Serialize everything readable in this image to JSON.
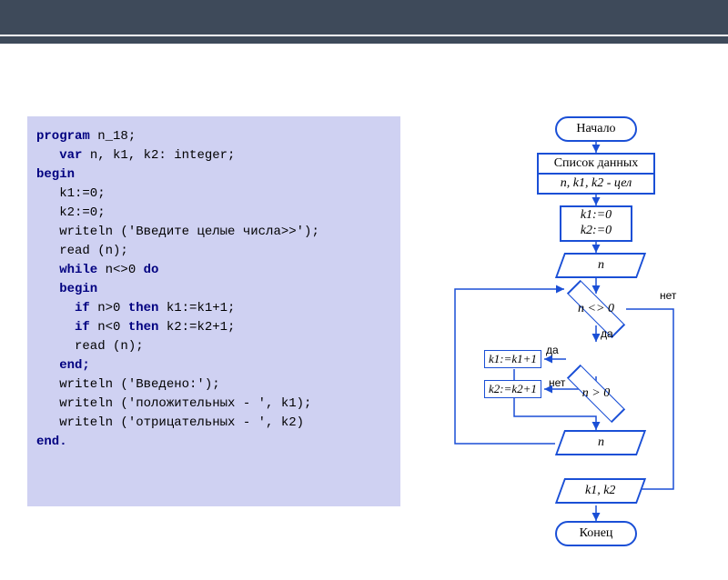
{
  "code": {
    "l1_a": "program",
    "l1_b": " n_18;",
    "l2_a": "   var",
    "l2_b": " n, k1, k2: integer;",
    "l3": "begin",
    "l4": "   k1:=0;",
    "l5": "   k2:=0;",
    "l6": "   writeln ('Введите целые числа>>');",
    "l7": "   read (n);",
    "l8_a": "   while",
    "l8_b": " n<>0 ",
    "l8_c": "do",
    "l9": "   begin",
    "l10_a": "     if",
    "l10_b": " n>0 ",
    "l10_c": "then",
    "l10_d": " k1:=k1+1;",
    "l11_a": "     if",
    "l11_b": " n<0 ",
    "l11_c": "then",
    "l11_d": " k2:=k2+1;",
    "l12": "     read (n);",
    "l13": "   end;",
    "l14": "   writeln ('Введено:');",
    "l15": "   writeln ('положительных - ', k1);",
    "l16": "   writeln ('отрицательных - ', k2)",
    "l17": "end."
  },
  "flow": {
    "start": "Начало",
    "list_title": "Список данных",
    "vars": "n, k1, k2 - цел",
    "init1": "k1:=0",
    "init2": "k2:=0",
    "input_n": "n",
    "cond1": "n <> 0",
    "cond2": "n > 0",
    "assign1": "k1:=k1+1",
    "assign2": "k2:=k2+1",
    "input_n2": "n",
    "output": "k1, k2",
    "end": "Конец",
    "yes": "да",
    "no": "нет"
  }
}
